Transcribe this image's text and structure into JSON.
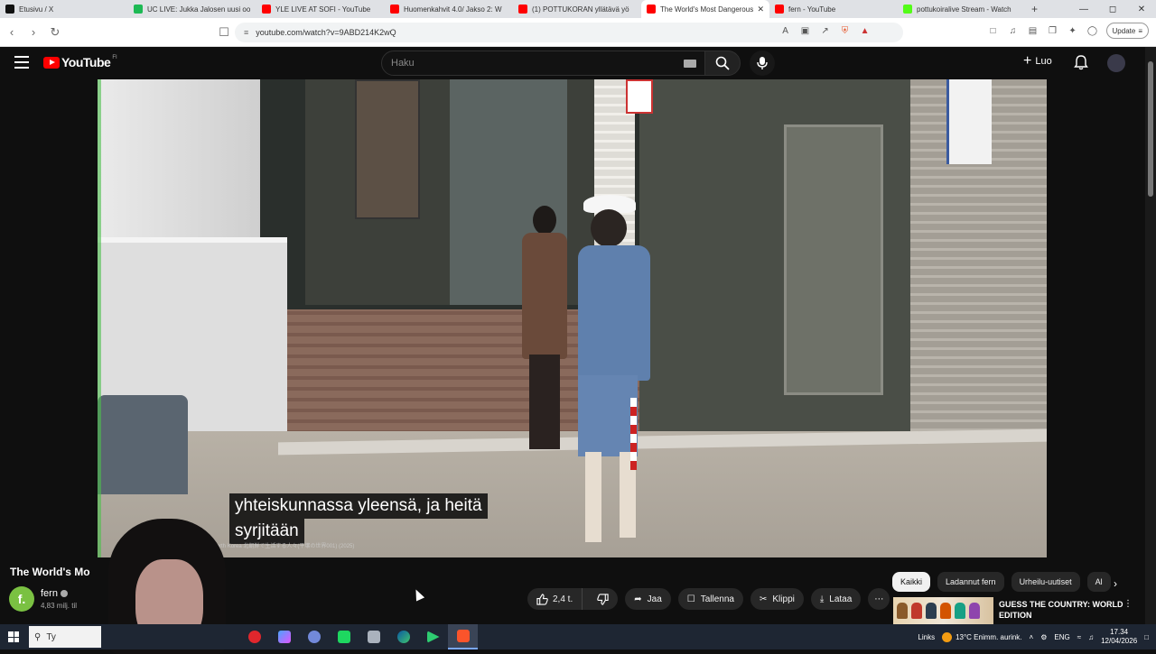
{
  "browser": {
    "tabs": [
      {
        "label": "Etusivu / X",
        "color": "#111111"
      },
      {
        "label": "UC LIVE: Jukka Jalosen uusi oo",
        "color": "#1db954"
      },
      {
        "label": "YLE LIVE AT SOFI - YouTube",
        "color": "#ff0000"
      },
      {
        "label": "Huomenkahvit 4.0/ Jakso 2: W",
        "color": "#ff0000"
      },
      {
        "label": "(1) POTTUKORAN yllätävä yö",
        "color": "#ff0000"
      },
      {
        "label": "The World's Most Dangerous",
        "color": "#ff0000",
        "active": true
      },
      {
        "label": "fern - YouTube",
        "color": "#ff0000"
      },
      {
        "label": "pottukoiralive Stream - Watch",
        "color": "#53fc18"
      }
    ],
    "new_tab": "+",
    "url": "youtube.com/watch?v=9ABD214K2wQ",
    "update_label": "Update"
  },
  "youtube": {
    "logo_text": "YouTube",
    "country_code": "FI",
    "search_placeholder": "Haku",
    "create_label": "Luo"
  },
  "video": {
    "subtitle_line1": "yhteiskunnassa yleensä, ja heitä",
    "subtitle_line2": "syrjitään",
    "watermark": "People North Korea 北朝鮮で生活する人々(平壌の世界001) (2025)",
    "title": "The World's Mo",
    "channel_name": "fern",
    "channel_initial": "f.",
    "channel_subs": "4,83 milj. til",
    "like_count": "2,4 t.",
    "share_label": "Jaa",
    "save_label": "Tallenna",
    "clip_label": "Klippi",
    "download_label": "Lataa"
  },
  "sidebar": {
    "chips": [
      "Kaikki",
      "Ladannut fern",
      "Urheilu-uutiset",
      "Al"
    ],
    "recommendation_title": "GUESS THE COUNTRY: WORLD EDITION"
  },
  "taskbar": {
    "search_text": "Ty",
    "links_label": "Links",
    "weather": "13°C  Enimm. aurink.",
    "language": "ENG",
    "time": "17.34",
    "date": "12/04/2026"
  }
}
